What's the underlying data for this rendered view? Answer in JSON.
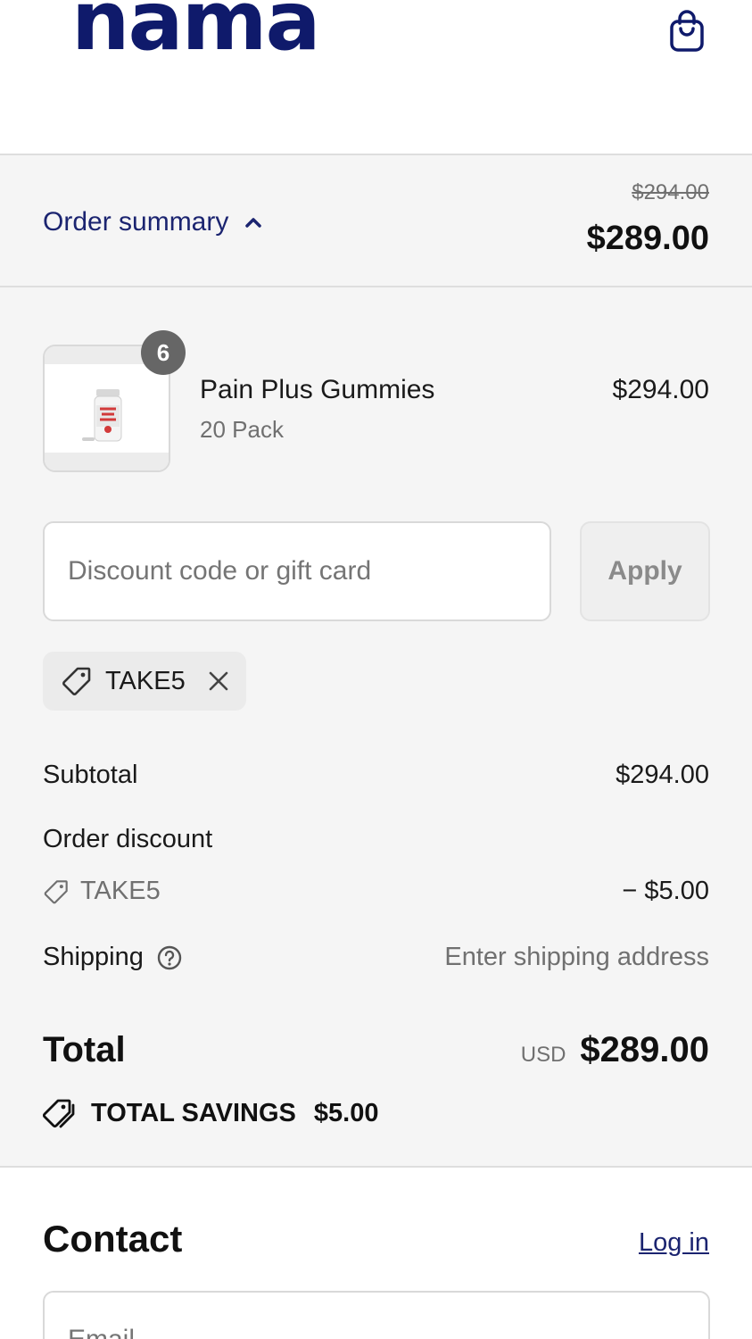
{
  "header": {
    "logo_text": "nama",
    "cart_icon": "shopping-bag-icon"
  },
  "summary": {
    "toggle_label": "Order summary",
    "toggle_icon": "chevron-up-icon",
    "original_total": "$294.00",
    "total": "$289.00"
  },
  "line_item": {
    "quantity": "6",
    "name": "Pain Plus Gummies",
    "variant": "20 Pack",
    "price": "$294.00"
  },
  "discount": {
    "placeholder": "Discount code or gift card",
    "apply_label": "Apply",
    "applied_code": "TAKE5"
  },
  "totals": {
    "subtotal_label": "Subtotal",
    "subtotal_value": "$294.00",
    "order_discount_label": "Order discount",
    "order_discount_code": "TAKE5",
    "order_discount_value": "− $5.00",
    "shipping_label": "Shipping",
    "shipping_value": "Enter shipping address",
    "total_label": "Total",
    "total_currency": "USD",
    "total_value": "$289.00",
    "savings_label": "TOTAL SAVINGS",
    "savings_value": "$5.00"
  },
  "contact": {
    "title": "Contact",
    "login_label": "Log in",
    "email_placeholder": "Email"
  },
  "colors": {
    "brand": "#0f1a6b",
    "link": "#1b2470",
    "panel_bg": "#f5f5f5"
  }
}
